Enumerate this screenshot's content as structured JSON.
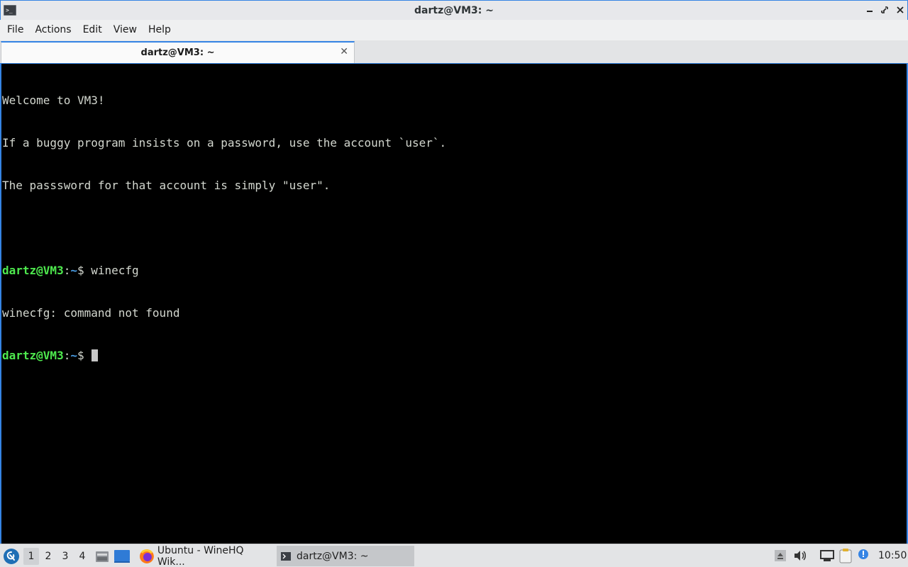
{
  "window": {
    "title": "dartz@VM3: ~",
    "app_icon_glyph": ">_"
  },
  "menu": {
    "items": [
      "File",
      "Actions",
      "Edit",
      "View",
      "Help"
    ]
  },
  "tabs": [
    {
      "label": "dartz@VM3: ~",
      "close_glyph": "✕"
    }
  ],
  "terminal": {
    "welcome_lines": [
      "Welcome to VM3!",
      "If a buggy program insists on a password, use the account `user`.",
      "The passsword for that account is simply \"user\"."
    ],
    "prompt_user": "dartz@VM3",
    "prompt_colon": ":",
    "prompt_path": "~",
    "prompt_symbol": "$ ",
    "command": "winecfg",
    "output": "winecfg: command not found",
    "colors": {
      "user": "#4ee94e",
      "path": "#4a9ee6",
      "text": "#d3d7cf",
      "background": "#000000"
    }
  },
  "taskbar": {
    "workspaces": [
      "1",
      "2",
      "3",
      "4"
    ],
    "active_workspace": "1",
    "launchers": [
      "file-manager-icon",
      "desktop-icon"
    ],
    "tasks": [
      {
        "icon": "firefox-icon",
        "label": "Ubuntu - WineHQ Wik..."
      },
      {
        "icon": "terminal-icon",
        "label": "dartz@VM3: ~"
      }
    ],
    "tray": [
      "eject-icon",
      "volume-icon",
      "network-icon",
      "clipboard-icon",
      "update-notifier-icon"
    ],
    "clock": "10:50"
  },
  "accent_color": "#3584e4"
}
